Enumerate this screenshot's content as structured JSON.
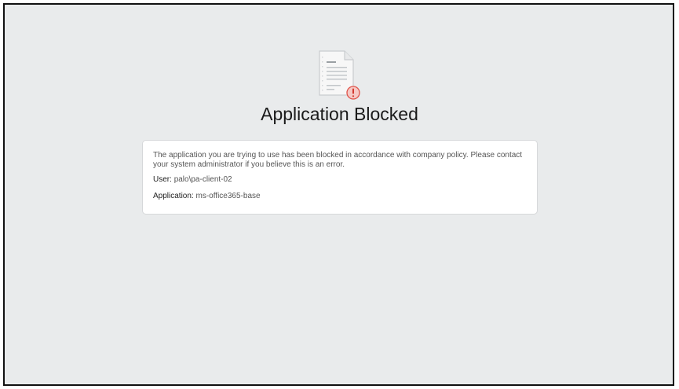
{
  "page": {
    "title": "Application Blocked"
  },
  "card": {
    "message": "The application you are trying to use has been blocked in accordance with company policy. Please contact your system administrator if you believe this is an error.",
    "user_label": "User:",
    "user_value": "palo\\pa-client-02",
    "application_label": "Application:",
    "application_value": "ms-office365-base"
  },
  "icons": {
    "header": "document-warning-icon"
  },
  "colors": {
    "background": "#e9ebec",
    "alert": "#e0534a"
  }
}
